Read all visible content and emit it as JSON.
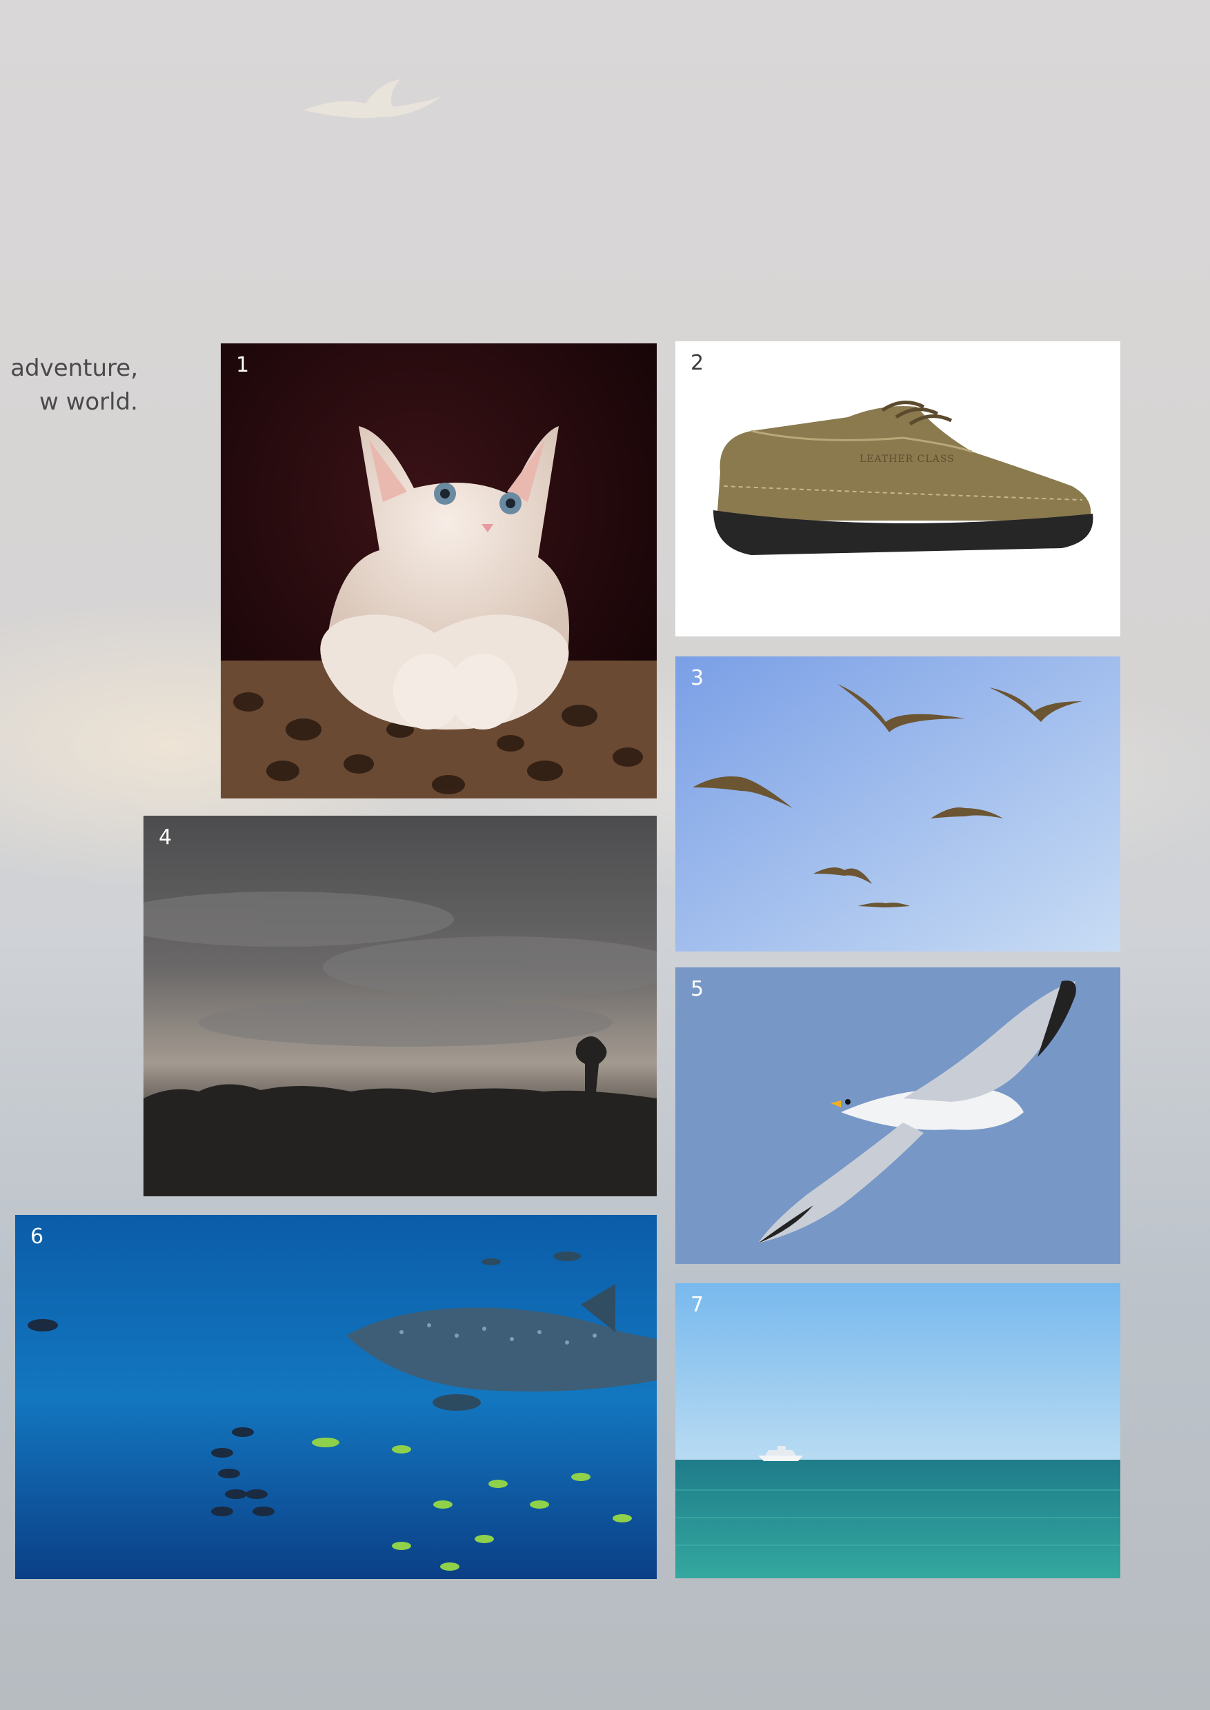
{
  "intro": {
    "line1": "adventure,",
    "line2": "w world."
  },
  "gallery": {
    "photos": [
      {
        "number": "1",
        "icon": "kitten-photo"
      },
      {
        "number": "2",
        "icon": "shoe-photo",
        "brand_text": "LEATHER CLASS"
      },
      {
        "number": "3",
        "icon": "seagulls-flock-photo"
      },
      {
        "number": "4",
        "icon": "storm-clouds-photo"
      },
      {
        "number": "5",
        "icon": "seagull-photo"
      },
      {
        "number": "6",
        "icon": "whale-shark-aquarium-photo"
      },
      {
        "number": "7",
        "icon": "sea-boat-photo"
      }
    ]
  },
  "colors": {
    "background": "#d6d4d3",
    "number_light": "#ffffff",
    "number_dark": "#3a3a3a"
  }
}
